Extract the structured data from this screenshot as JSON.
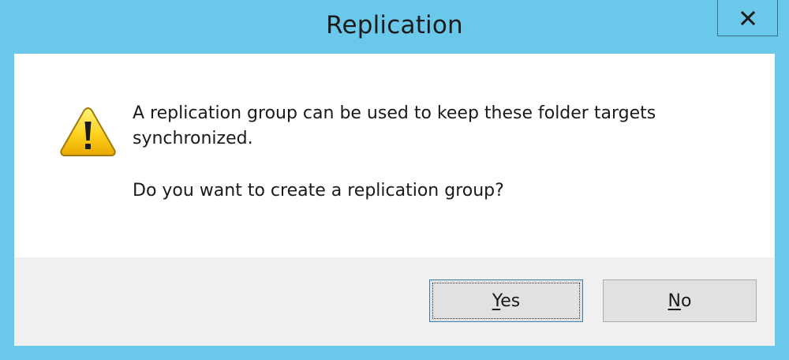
{
  "window": {
    "title": "Replication",
    "close_icon": "close-icon",
    "colors": {
      "frame": "#6ac8ea",
      "content": "#ffffff",
      "footer": "#f0f0f0",
      "button": "#e1e1e1",
      "focus_border": "#3c7fb1"
    }
  },
  "dialog": {
    "icon": "warning-icon",
    "message_line1": "A replication group can be used to keep these folder targets",
    "message_line2": "synchronized.",
    "question": "Do you want to create a replication group?"
  },
  "buttons": {
    "yes": {
      "accel": "Y",
      "rest": "es"
    },
    "no": {
      "accel": "N",
      "rest": "o"
    }
  }
}
